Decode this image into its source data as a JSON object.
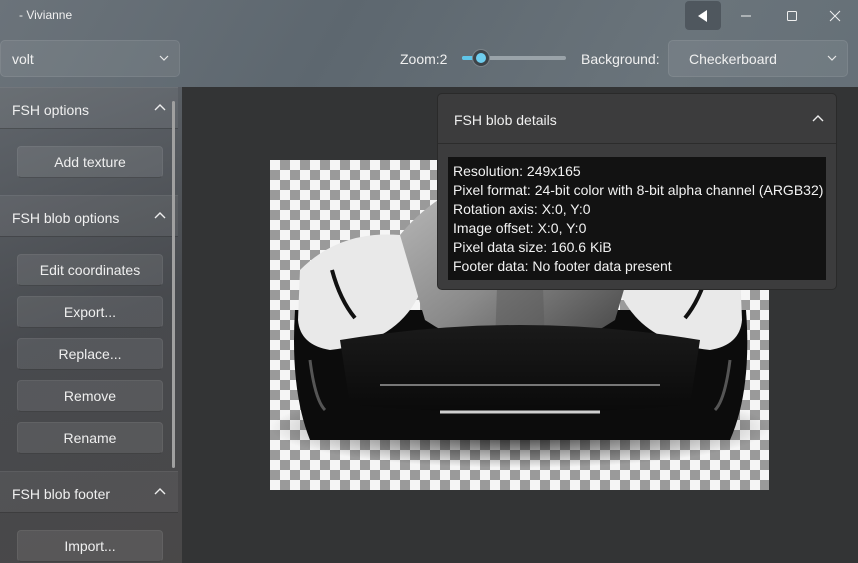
{
  "window": {
    "title": "- Vivianne"
  },
  "toolbar": {
    "file_combo_value": "volt",
    "zoom_label": "Zoom:2",
    "zoom_level": 2,
    "zoom_fraction": 0.18,
    "background_label": "Background:",
    "background_value": "Checkerboard"
  },
  "sidebar": {
    "fsh_options": {
      "title": "FSH options",
      "add_texture": "Add texture"
    },
    "fsh_blob_options": {
      "title": "FSH blob options",
      "edit_coordinates": "Edit coordinates",
      "export": "Export...",
      "replace": "Replace...",
      "remove": "Remove",
      "rename": "Rename"
    },
    "fsh_blob_footer": {
      "title": "FSH blob footer",
      "import": "Import..."
    }
  },
  "details": {
    "title": "FSH blob details",
    "resolution": "Resolution: 249x165",
    "pixel_format": "Pixel format: 24-bit color with 8-bit alpha channel (ARGB32)",
    "rotation_axis": "Rotation axis: X:0, Y:0",
    "image_offset": "Image offset: X:0, Y:0",
    "pixel_data_size": "Pixel data size: 160.6 KiB",
    "footer_data": "Footer data: No footer data present"
  },
  "colors": {
    "accent": "#5fc5e9",
    "panel": "#3c3c3d",
    "content_bg": "#333435"
  }
}
